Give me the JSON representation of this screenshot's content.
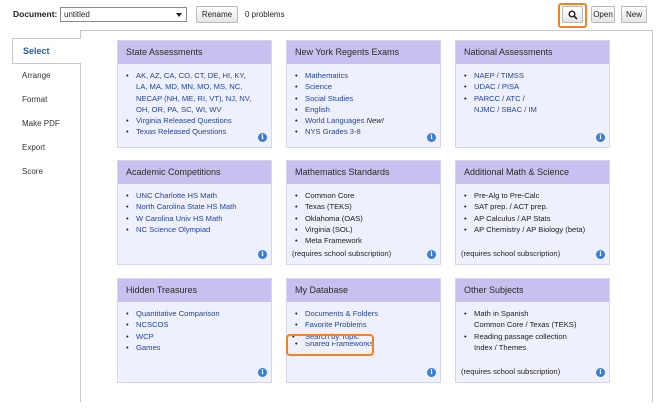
{
  "toolbar": {
    "document_label": "Document:",
    "document_value": "untitled",
    "rename_label": "Rename",
    "problems_text": "0 problems",
    "search_icon": "magnifier-icon",
    "open_label": "Open",
    "new_label": "New"
  },
  "sidebar": {
    "items": [
      {
        "label": "Select",
        "active": true
      },
      {
        "label": "Arrange"
      },
      {
        "label": "Format"
      },
      {
        "label": "Make PDF"
      },
      {
        "label": "Export"
      },
      {
        "label": "Score"
      }
    ]
  },
  "cards": {
    "state": {
      "title": "State Assessments",
      "items": [
        "AK, AZ, CA, CO, CT, DE, HI, KY,",
        "Virginia Released Questions",
        "Texas Released Questions"
      ],
      "item0_cont": [
        "LA, MA, MD, MN, MO, MS, NC,",
        "NECAP (NH, ME, RI, VT), NJ, NV,",
        "OH, OR, PA, SC, WI, WV"
      ]
    },
    "regents": {
      "title": "New York Regents Exams",
      "items": [
        "Mathematics",
        "Science",
        "Social Studies",
        "English",
        "World Languages",
        "NYS Grades 3-8"
      ],
      "new_tag": "New!"
    },
    "national": {
      "title": "National Assessments",
      "items": [
        "NAEP / TIMSS",
        "UDAC / PISA",
        "PARCC / ATC /"
      ],
      "item2_cont": "NJMC / SBAC / IM"
    },
    "competitions": {
      "title": "Academic Competitions",
      "items": [
        "UNC Charlotte HS Math",
        "North Carolina State HS Math",
        "W Carolina Univ HS Math",
        "NC Science Olympiad"
      ]
    },
    "standards": {
      "title": "Mathematics Standards",
      "items": [
        "Common Core",
        "Texas (TEKS)",
        "Oklahoma (OAS)",
        "Virginia (SOL)",
        "Meta Framework"
      ],
      "note": "(requires school subscription)"
    },
    "additional": {
      "title": "Additional Math & Science",
      "items": [
        "Pre-Alg to Pre-Calc",
        "SAT prep. / ACT prep.",
        "AP Calculus / AP Stats",
        "AP Chemistry / AP Biology (beta)"
      ],
      "note": "(requires school subscription)"
    },
    "treasures": {
      "title": "Hidden Treasures",
      "items": [
        "Quantitative Comparison",
        "NCSCOS",
        "WCP",
        "Games"
      ]
    },
    "database": {
      "title": "My Database",
      "items": [
        "Documents & Folders",
        "Favorite Problems",
        "Search by Topic",
        "Shared Frameworks"
      ]
    },
    "other": {
      "title": "Other Subjects",
      "items": [
        "Math in Spanish",
        "Reading passage collection"
      ],
      "item0_cont": "Common Core / Texas (TEKS)",
      "item1_cont": "Index / Themes",
      "note": "(requires school subscription)"
    }
  },
  "info_icon_glyph": "i",
  "colors": {
    "accent_highlight": "#f5821f",
    "card_header": "#c8c0ef",
    "card_body": "#eef0fb",
    "link": "#2244aa",
    "active_tab": "#1f5dbb"
  }
}
